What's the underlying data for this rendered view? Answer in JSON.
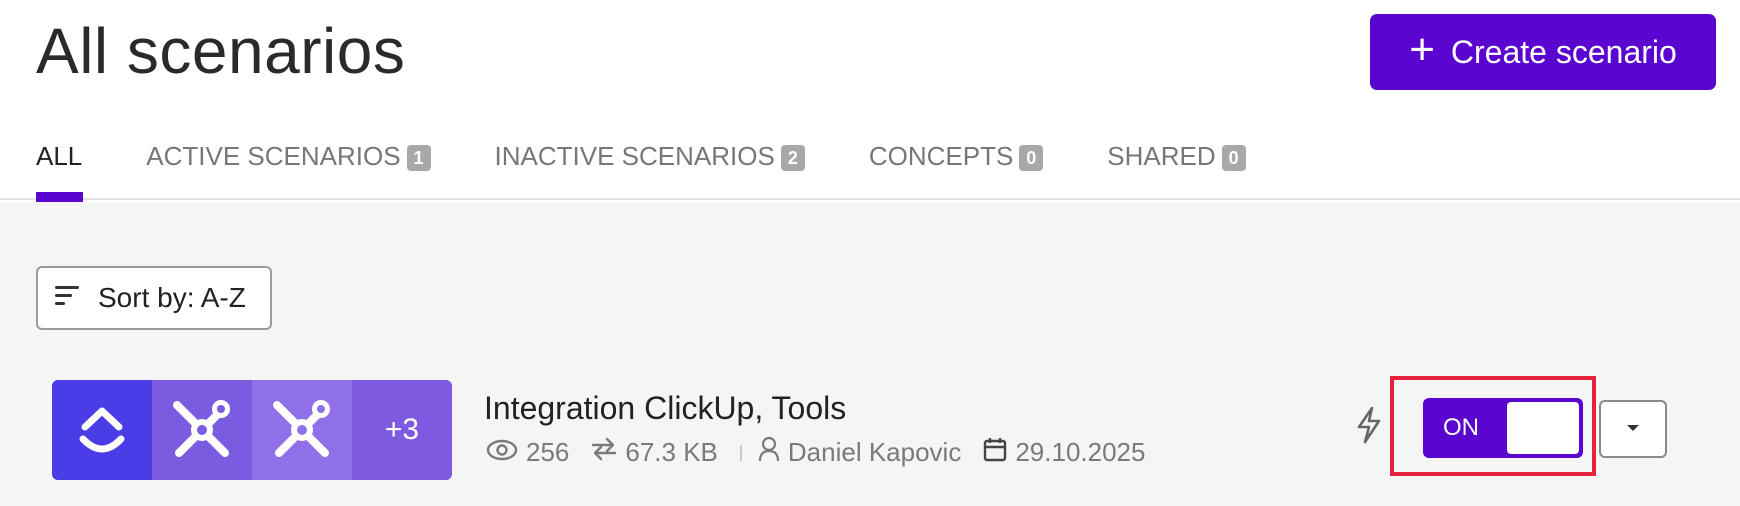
{
  "header": {
    "title": "All scenarios",
    "create_button": {
      "icon": "plus-icon",
      "label": "Create scenario"
    }
  },
  "tabs": [
    {
      "label": "ALL",
      "active": true
    },
    {
      "label": "ACTIVE SCENARIOS",
      "count": "1"
    },
    {
      "label": "INACTIVE SCENARIOS",
      "count": "2"
    },
    {
      "label": "CONCEPTS",
      "count": "0"
    },
    {
      "label": "SHARED",
      "count": "0"
    }
  ],
  "sort": {
    "label": "Sort by: A-Z",
    "icon": "sort-lines-icon"
  },
  "scenario": {
    "apps": [
      "clickup-icon",
      "tools-icon",
      "tools-icon"
    ],
    "more_apps": "+3",
    "name": "Integration ClickUp, Tools",
    "operations": "256",
    "data_transfer": "67.3 KB",
    "owner": "Daniel Kapovic",
    "date": "29.10.2025",
    "toggle_label": "ON",
    "toggle_state": true
  },
  "colors": {
    "accent": "#5b05d0",
    "highlight": "#e6223a",
    "tile_1": "#4a3de8",
    "tile_2": "#7a5ce0",
    "tile_3": "#9070e8"
  }
}
